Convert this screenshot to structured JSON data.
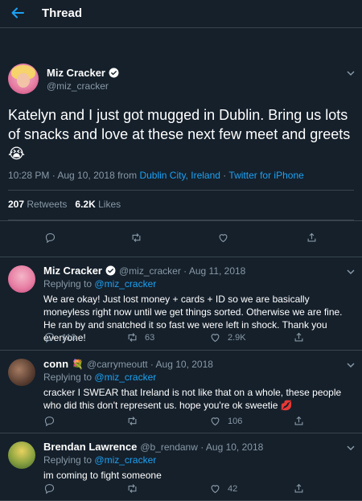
{
  "header": {
    "title": "Thread"
  },
  "main_tweet": {
    "display_name": "Miz Cracker",
    "handle": "@miz_cracker",
    "text": "Katelyn and I just got mugged in Dublin. Bring us lots of snacks and love at these next few meet and greets",
    "emoji": "😭",
    "time": "10:28 PM · Aug 10, 2018 from",
    "location": "Dublin City, Ireland",
    "separator": "·",
    "client": "Twitter for iPhone",
    "retweets_count": "207",
    "retweets_label": "Retweets",
    "likes_count": "6.2K",
    "likes_label": "Likes"
  },
  "replies": [
    {
      "display_name": "Miz Cracker",
      "handle": "@miz_cracker · Aug 11, 2018",
      "replying_label": "Replying to",
      "replying_to": "@miz_cracker",
      "text": "We are okay! Just lost money + cards + ID so we are basically moneyless right now until we get things sorted. Otherwise we are fine. He ran by and snatched it so fast we were left in shock. Thank you everyone!",
      "retweets": "63",
      "likes": "2.9K",
      "replies": "113"
    },
    {
      "display_name": "conn",
      "name_emoji": "💐",
      "handle": "@carrymeoutt · Aug 10, 2018",
      "replying_label": "Replying to",
      "replying_to": "@miz_cracker",
      "text": "cracker I SWEAR that Ireland is not like that on a whole, these people who did this don't represent us. hope you're ok sweetie",
      "text_emoji": "💋",
      "likes": "106"
    },
    {
      "display_name": "Brendan Lawrence",
      "handle": "@b_rendanw · Aug 10, 2018",
      "replying_label": "Replying to",
      "replying_to": "@miz_cracker",
      "text": "im coming to fight someone",
      "likes": "42"
    }
  ],
  "colors": {
    "background": "#15202b",
    "accent": "#1da1f2",
    "muted": "#8899a6",
    "border": "#38444d"
  }
}
